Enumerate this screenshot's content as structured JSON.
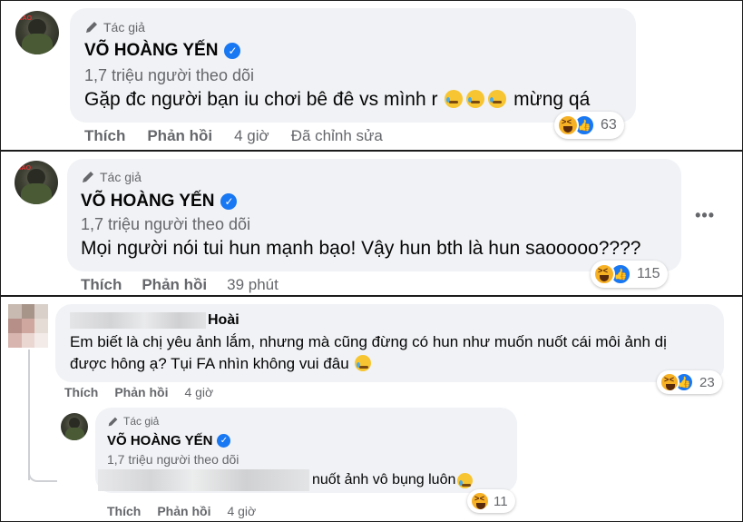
{
  "comments": [
    {
      "author_tag": "Tác giả",
      "name": "VÕ HOÀNG YẾN",
      "followers": "1,7 triệu người theo dõi",
      "text_before": "Gặp đc người bạn iu chơi bê đê vs mình r",
      "text_after": "mừng qá",
      "reaction_count": "63",
      "actions": {
        "like": "Thích",
        "reply": "Phản hồi",
        "time": "4 giờ",
        "edited": "Đã chỉnh sửa"
      }
    },
    {
      "author_tag": "Tác giả",
      "name": "VÕ HOÀNG YẾN",
      "followers": "1,7 triệu người theo dõi",
      "text": "Mọi người nói tui hun mạnh bạo! Vậy hun bth là hun saooooo????",
      "reaction_count": "115",
      "actions": {
        "like": "Thích",
        "reply": "Phản hồi",
        "time": "39 phút"
      }
    },
    {
      "name_suffix": "Hoài",
      "line1": "Em biết là chị yêu ảnh lắm, nhưng mà cũng đừng có hun như muốn nuốt cái môi ảnh dị",
      "line2": "được hông ạ? Tụi FA nhìn không vui đâu",
      "reaction_count": "23",
      "actions": {
        "like": "Thích",
        "reply": "Phản hồi",
        "time": "4 giờ"
      }
    },
    {
      "author_tag": "Tác giả",
      "name": "VÕ HOÀNG YẾN",
      "followers": "1,7 triệu người theo dõi",
      "text": "nuốt ảnh vô bụng luôn",
      "reaction_count": "11",
      "actions": {
        "like": "Thích",
        "reply": "Phản hồi",
        "time": "4 giờ"
      }
    }
  ],
  "icons": [
    "pen-icon",
    "verified-badge-icon",
    "haha-reaction-icon",
    "like-reaction-icon",
    "crying-face-emoji",
    "laughing-emoji",
    "more-options-icon"
  ],
  "colors": {
    "accent": "#1877f2",
    "bubble": "#f0f2f5",
    "muted": "#65676b"
  }
}
